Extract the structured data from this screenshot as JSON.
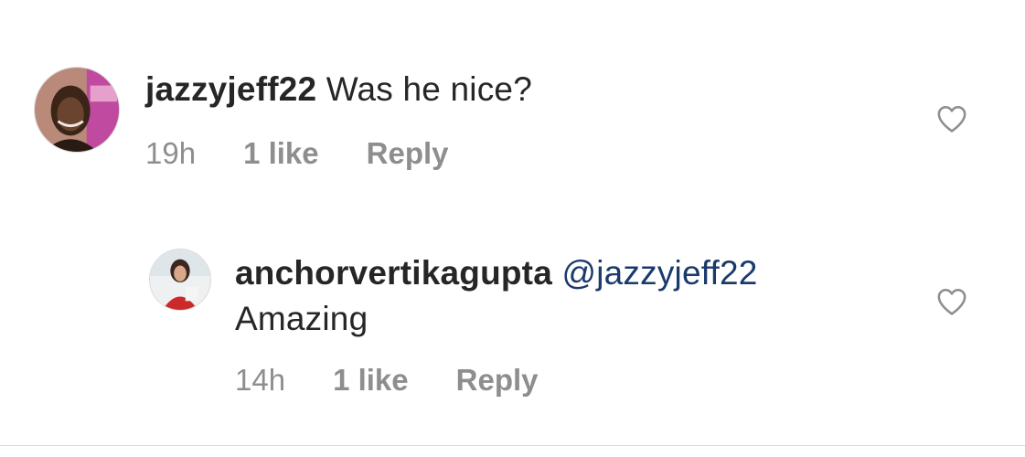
{
  "comments": [
    {
      "username": "jazzyjeff22",
      "text": "Was he nice?",
      "time": "19h",
      "likes": "1 like",
      "reply_label": "Reply"
    },
    {
      "username": "anchorvertikagupta",
      "mention": "@jazzyjeff22",
      "text": "Amazing",
      "time": "14h",
      "likes": "1 like",
      "reply_label": "Reply"
    }
  ],
  "colors": {
    "text": "#262626",
    "meta": "#8e8e8e",
    "mention": "#1a3a6c",
    "heart_stroke": "#8e8e8e"
  },
  "icons": {
    "like": "heart-outline-icon"
  }
}
